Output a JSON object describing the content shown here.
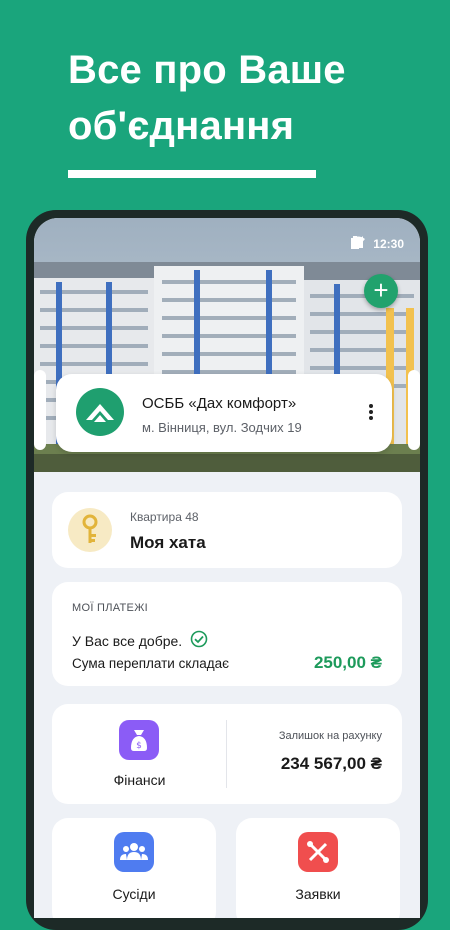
{
  "headline": {
    "line1": "Все про Ваше",
    "line2": "об'єднання"
  },
  "statusbar": {
    "time": "12:30"
  },
  "org": {
    "name": "ОСББ «Дах комфорт»",
    "address": "м. Вінниця, вул. Зодчих 19"
  },
  "apartment": {
    "label": "Квартира 48",
    "name": "Моя хата"
  },
  "payments": {
    "section": "МОЇ ПЛАТЕЖІ",
    "status": "У Вас все добре.",
    "subtitle": "Сума переплати складає",
    "amount": "250,00 ₴"
  },
  "finance": {
    "label": "Фінанси",
    "balance_label": "Залишок на рахунку",
    "balance_value": "234 567,00 ₴"
  },
  "tiles": {
    "neighbors": "Сусіди",
    "requests": "Заявки"
  },
  "colors": {
    "brand_green": "#1aa57c",
    "finance_purple": "#8b5cf6",
    "neighbors_blue": "#4f7cf0",
    "requests_red": "#f04e4e",
    "positive_amount": "#1d9a5b"
  }
}
